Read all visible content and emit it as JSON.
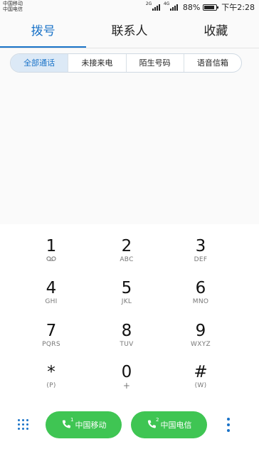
{
  "status_bar": {
    "carrier_1": "中国移动",
    "carrier_2": "中国电信",
    "network_1": "2G",
    "network_2": "4G",
    "battery_percent": "88%",
    "battery_level": 0.88,
    "time": "下午2:28"
  },
  "tabs": [
    {
      "label": "拨号",
      "active": true
    },
    {
      "label": "联系人",
      "active": false
    },
    {
      "label": "收藏",
      "active": false
    }
  ],
  "filters": [
    {
      "label": "全部通话",
      "active": true
    },
    {
      "label": "未接来电",
      "active": false
    },
    {
      "label": "陌生号码",
      "active": false
    },
    {
      "label": "语音信箱",
      "active": false
    }
  ],
  "keypad": [
    {
      "digit": "1",
      "letters": ""
    },
    {
      "digit": "2",
      "letters": "ABC"
    },
    {
      "digit": "3",
      "letters": "DEF"
    },
    {
      "digit": "4",
      "letters": "GHI"
    },
    {
      "digit": "5",
      "letters": "JKL"
    },
    {
      "digit": "6",
      "letters": "MNO"
    },
    {
      "digit": "7",
      "letters": "PQRS"
    },
    {
      "digit": "8",
      "letters": "TUV"
    },
    {
      "digit": "9",
      "letters": "WXYZ"
    },
    {
      "digit": "*",
      "letters": "(P)"
    },
    {
      "digit": "0",
      "letters": "+"
    },
    {
      "digit": "#",
      "letters": "(W)"
    }
  ],
  "call_buttons": [
    {
      "label": "中国移动",
      "sim": "1"
    },
    {
      "label": "中国电信",
      "sim": "2"
    }
  ],
  "colors": {
    "accent": "#1a73c8",
    "call_green": "#3fc553",
    "filter_active_bg": "#dce9f6"
  },
  "icons": {
    "voicemail": "voicemail-icon",
    "dialpad_toggle": "dialpad-grid-icon",
    "call": "phone-icon",
    "more": "more-vert-icon"
  }
}
